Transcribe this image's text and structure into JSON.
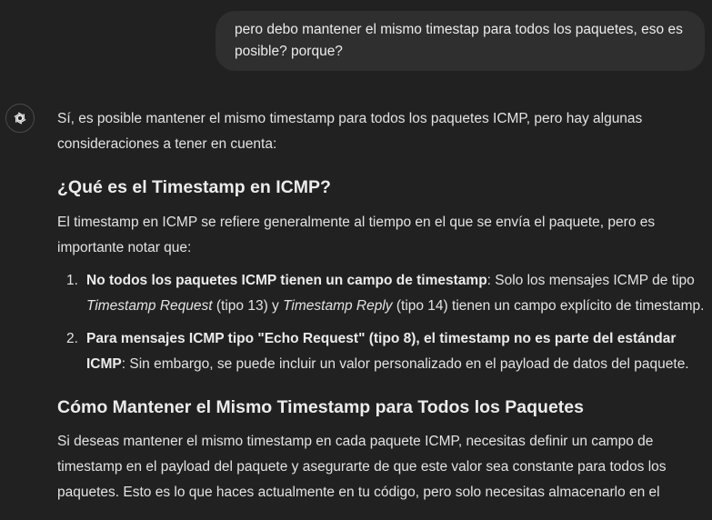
{
  "user_message": {
    "text": "pero debo mantener el mismo timestap para todos los paquetes, eso es posible? porque?"
  },
  "assistant": {
    "avatar_icon": "openai-logo-icon",
    "intro": "Sí, es posible mantener el mismo timestamp para todos los paquetes ICMP, pero hay algunas consideraciones a tener en cuenta:",
    "heading1": "¿Qué es el Timestamp en ICMP?",
    "para1": "El timestamp en ICMP se refiere generalmente al tiempo en el que se envía el paquete, pero es importante notar que:",
    "list": [
      {
        "num": "1.",
        "bold": "No todos los paquetes ICMP tienen un campo de timestamp",
        "t1": ": Solo los mensajes ICMP de tipo ",
        "i1": "Timestamp Request",
        "t2": " (tipo 13) y ",
        "i2": "Timestamp Reply",
        "t3": " (tipo 14) tienen un campo explícito de timestamp."
      },
      {
        "num": "2.",
        "bold": "Para mensajes ICMP tipo \"Echo Request\" (tipo 8), el timestamp no es parte del estándar ICMP",
        "t1": ": Sin embargo, se puede incluir un valor personalizado en el payload de datos del paquete."
      }
    ],
    "heading2": "Cómo Mantener el Mismo Timestamp para Todos los Paquetes",
    "para2": "Si deseas mantener el mismo timestamp en cada paquete ICMP, necesitas definir un campo de timestamp en el payload del paquete y asegurarte de que este valor sea constante para todos los paquetes. Esto es lo que haces actualmente en tu código, pero solo necesitas almacenarlo en el"
  }
}
